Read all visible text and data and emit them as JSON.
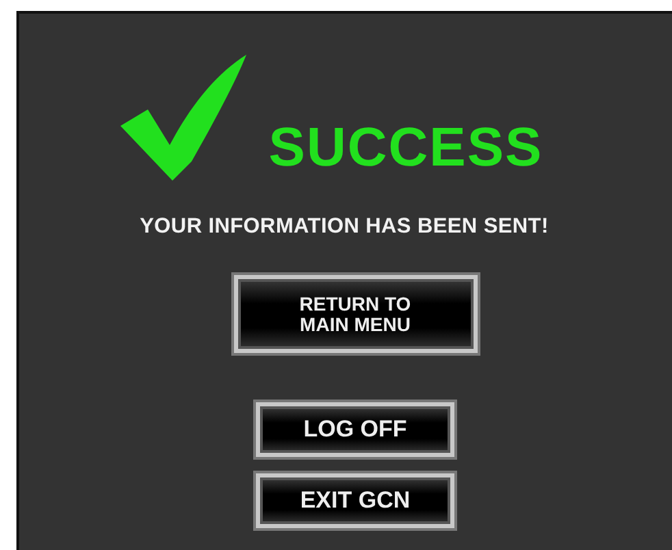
{
  "status": {
    "title": "SUCCESS",
    "message": "YOUR INFORMATION HAS BEEN SENT!"
  },
  "buttons": [
    {
      "label": "RETURN TO MAIN MENU",
      "kind": "large"
    },
    {
      "label": "LOG OFF",
      "kind": "small"
    },
    {
      "label": "EXIT GCN",
      "kind": "small"
    }
  ]
}
